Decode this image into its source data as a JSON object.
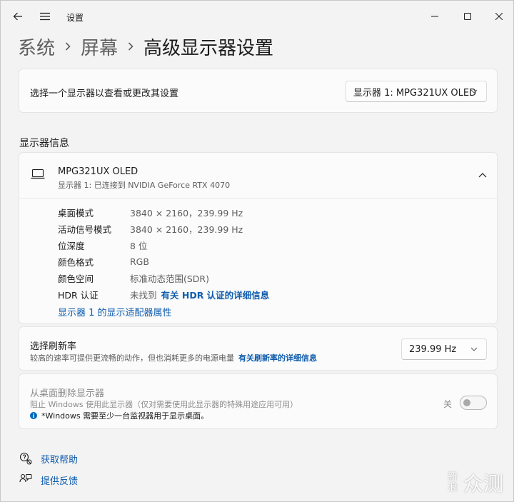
{
  "window": {
    "title": "设置"
  },
  "breadcrumb": {
    "items": [
      "系统",
      "屏幕"
    ],
    "current": "高级显示器设置"
  },
  "select_display": {
    "label": "选择一个显示器以查看或更改其设置",
    "value": "显示器 1: MPG321UX OLED"
  },
  "display_info": {
    "section_title": "显示器信息",
    "monitor_name": "MPG321UX OLED",
    "monitor_sub": "显示器 1: 已连接到 NVIDIA GeForce RTX 4070",
    "rows": [
      {
        "key": "桌面模式",
        "value": "3840 × 2160，239.99 Hz"
      },
      {
        "key": "活动信号模式",
        "value": "3840 × 2160，239.99 Hz"
      },
      {
        "key": "位深度",
        "value": "8 位"
      },
      {
        "key": "颜色格式",
        "value": "RGB"
      },
      {
        "key": "颜色空间",
        "value": "标准动态范围(SDR)"
      },
      {
        "key": "HDR 认证",
        "value": "未找到",
        "link": "有关 HDR 认证的详细信息"
      }
    ],
    "adapter_link": "显示器 1 的显示适配器属性"
  },
  "refresh_rate": {
    "title": "选择刷新率",
    "desc": "较高的速率可提供更流畅的动作，但也消耗更多的电源电量",
    "link": "有关刷新率的详细信息",
    "value": "239.99 Hz"
  },
  "remove_display": {
    "title": "从桌面删除显示器",
    "desc": "阻止 Windows 使用此显示器（仅对需要使用此显示器的特殊用途应用可用）",
    "note": "*Windows 需要至少一台监视器用于显示桌面。",
    "toggle_label": "关",
    "toggle_on": false
  },
  "footer": {
    "help": "获取帮助",
    "feedback": "提供反馈"
  },
  "watermark": {
    "small": "新浪",
    "large": "众测"
  },
  "colors": {
    "accent": "#0067c0",
    "link": "#0f5cad",
    "background": "#f3f3f3",
    "card": "#fbfbfb"
  }
}
